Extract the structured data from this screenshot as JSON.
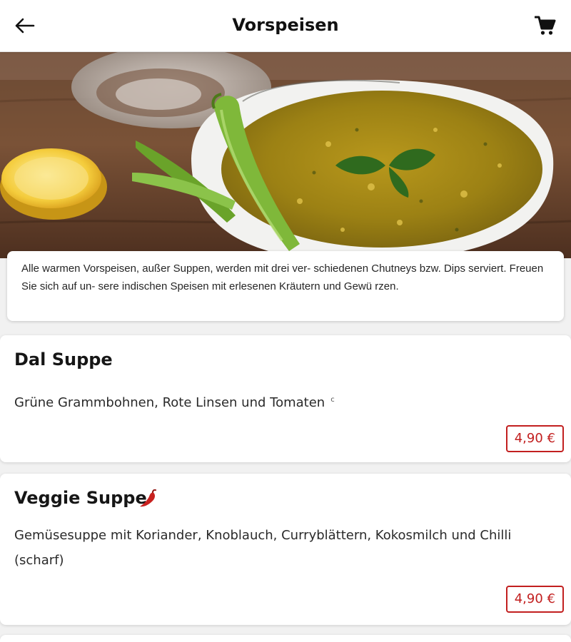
{
  "header": {
    "title": "Vorspeisen",
    "back_icon": "arrow-left-icon",
    "cart_icon": "shopping-cart-icon"
  },
  "hero": {
    "image": "lentil-soup-photo"
  },
  "info": {
    "text": "Alle warmen Vorspeisen, außer Suppen, werden mit drei ver- schiedenen Chutneys bzw. Dips serviert. Freuen Sie sich auf un- sere indischen Speisen mit erlesenen Kräutern und Gewü rzen."
  },
  "items": [
    {
      "name": "Dal Suppe",
      "description": "Grüne Grammbohnen, Rote Linsen und Tomaten",
      "allergen": "c",
      "price": "4,90 €",
      "spicy": false
    },
    {
      "name": "Veggie Suppe",
      "description": "Gemüsesuppe mit Koriander, Knoblauch, Curryblättern, Kokosmilch und Chilli (scharf)",
      "price": "4,90 €",
      "spicy": true,
      "spicy_icon": "chili-pepper-icon"
    }
  ],
  "colors": {
    "accent": "#c21f1f",
    "background": "#f1f1f1",
    "card": "#ffffff"
  }
}
